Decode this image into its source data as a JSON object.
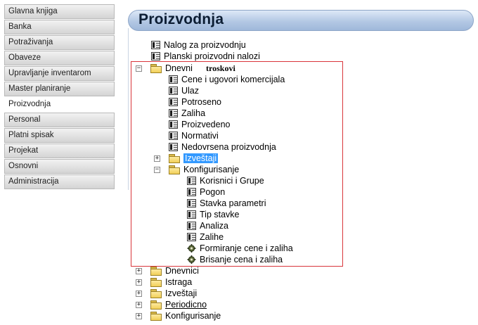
{
  "nav": {
    "items": [
      {
        "label": "Glavna knjiga"
      },
      {
        "label": "Banka"
      },
      {
        "label": "Potraživanja"
      },
      {
        "label": "Obaveze"
      },
      {
        "label": "Upravljanje inventarom"
      },
      {
        "label": "Master planiranje"
      },
      {
        "label": "Proizvodnja",
        "active": true
      },
      {
        "label": "Personal"
      },
      {
        "label": "Platni spisak"
      },
      {
        "label": "Projekat"
      },
      {
        "label": "Osnovni"
      },
      {
        "label": "Administracija"
      }
    ]
  },
  "header": {
    "title": "Proizvodnja"
  },
  "annotation": {
    "text": "troskovi"
  },
  "tree": {
    "nalog": "Nalog za proizvodnju",
    "planski": "Planski proizvodni nalozi",
    "dnevni": {
      "label": "Dnevni",
      "expander": "−",
      "items": [
        "Cene i ugovori komercijala",
        "Ulaz",
        "Potroseno",
        "Zaliha",
        "Proizvedeno",
        "Normativi",
        "Nedovrsena proizvodnja"
      ],
      "izvestaji": {
        "label": "Izveštaji",
        "expander": "+"
      },
      "konfigurisanje": {
        "label": "Konfigurisanje",
        "expander": "−",
        "items": [
          "Korisnici i Grupe",
          "Pogon",
          "Stavka parametri",
          "Tip stavke",
          "Analiza",
          "Zalihe"
        ],
        "actions": [
          "Formiranje cene i zaliha",
          "Brisanje cena i zaliha"
        ]
      }
    },
    "bottom": [
      {
        "label": "Dnevnici",
        "expander": "+"
      },
      {
        "label": "Istraga",
        "expander": "+"
      },
      {
        "label": "Izveštaji",
        "expander": "+"
      },
      {
        "label": "Periodicno",
        "expander": "+",
        "underlined": true
      },
      {
        "label": "Konfigurisanje",
        "expander": "+"
      }
    ]
  }
}
